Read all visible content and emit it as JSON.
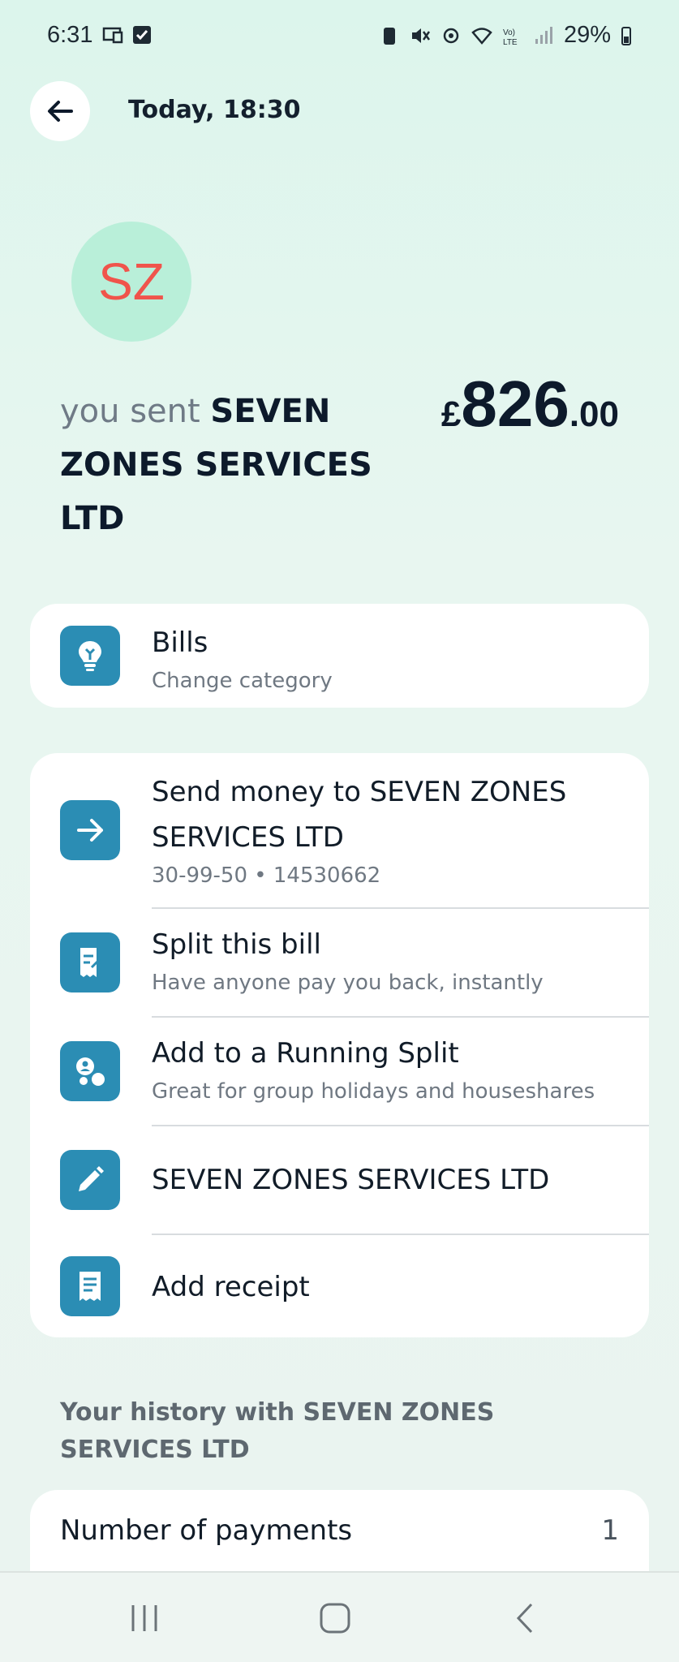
{
  "status_bar": {
    "time": "6:31",
    "battery": "29%"
  },
  "header": {
    "title": "Today, 18:30"
  },
  "payee": {
    "initials": "SZ",
    "prefix": "you sent ",
    "name": "SEVEN ZONES SERVICES LTD",
    "currency": "£",
    "amount_int": "826",
    "amount_dec": ".00"
  },
  "category": {
    "title": "Bills",
    "subtitle": "Change category"
  },
  "actions": [
    {
      "title": "Send money to SEVEN ZONES SERVICES LTD",
      "subtitle": "30-99-50 • 14530662"
    },
    {
      "title": "Split this bill",
      "subtitle": "Have anyone pay you back, instantly"
    },
    {
      "title": "Add to a Running Split",
      "subtitle": "Great for group holidays and houseshares"
    },
    {
      "title": "SEVEN ZONES SERVICES LTD",
      "subtitle": ""
    },
    {
      "title": "Add receipt",
      "subtitle": ""
    }
  ],
  "history": {
    "title": "Your history with SEVEN ZONES SERVICES LTD",
    "payments_label": "Number of payments",
    "payments_count": "1"
  },
  "colors": {
    "accent": "#2b8db4",
    "avatar_bg": "#b9efd9",
    "avatar_text": "#f0544b"
  }
}
